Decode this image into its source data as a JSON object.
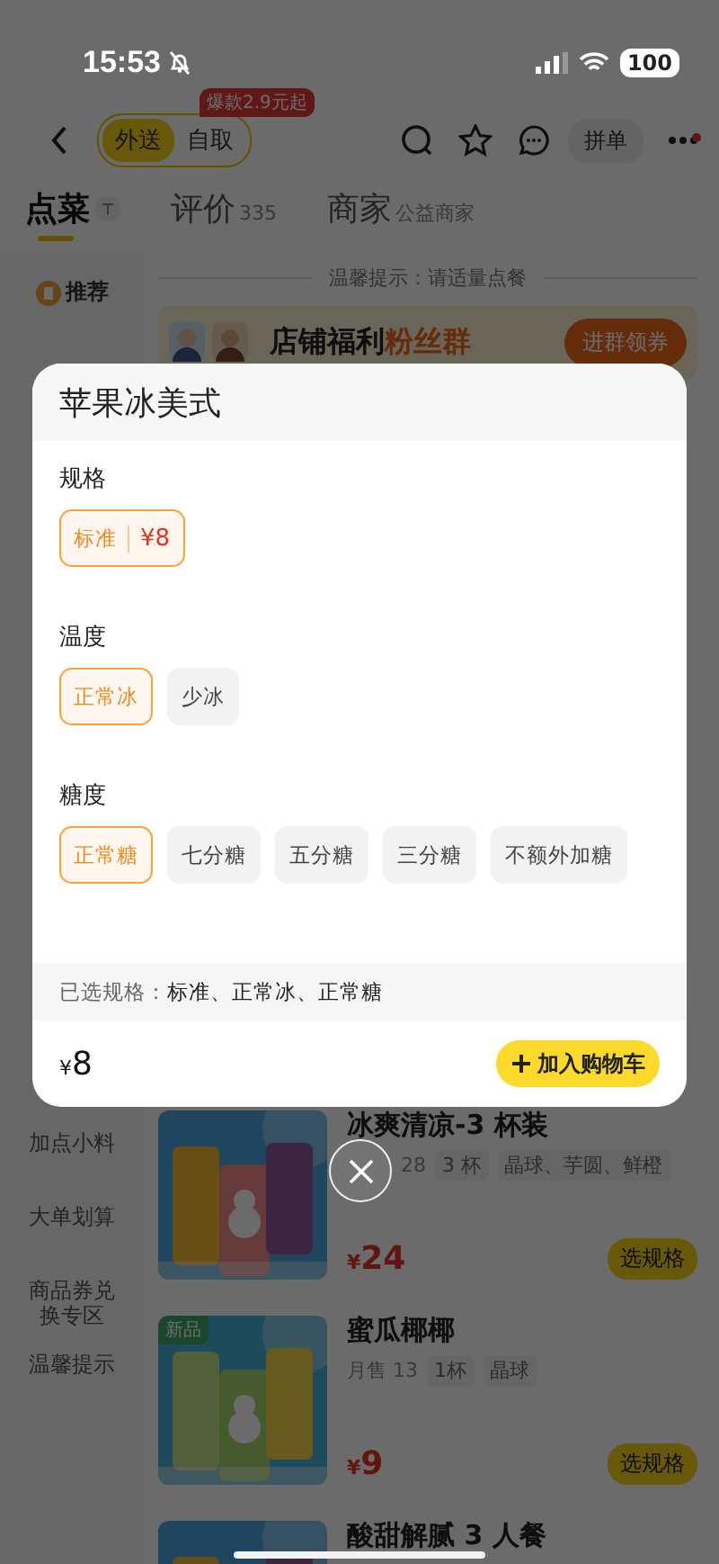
{
  "status_bar": {
    "time": "15:53",
    "battery": "100"
  },
  "nav": {
    "modes": [
      {
        "label": "外送",
        "selected": true
      },
      {
        "label": "自取",
        "selected": false
      }
    ],
    "promo_badge": "爆款2.9元起",
    "group_order": "拼单",
    "has_notification": true
  },
  "tabs": [
    {
      "label": "点菜",
      "selected": true
    },
    {
      "label": "评价",
      "count": "335",
      "selected": false
    },
    {
      "label": "商家",
      "count": "公益商家",
      "selected": false
    }
  ],
  "notice": "温馨提示：请适量点餐",
  "banner": {
    "title": "店铺福利",
    "highlight": "粉丝群",
    "button": "进群领券"
  },
  "sidebar": {
    "top": {
      "label": "推荐"
    },
    "items": [
      "加点小料",
      "大单划算",
      "商品券兑换专区",
      "温馨提示"
    ]
  },
  "products": [
    {
      "name": "冰爽清凉-3 杯装",
      "sales": "28",
      "sales_partly_hidden": true,
      "tags": [
        "3 杯",
        "晶球、芋圆、鲜橙"
      ],
      "currency": "¥",
      "price": "24",
      "button": "选规格"
    },
    {
      "name": "蜜瓜椰椰",
      "sales": "月售 13",
      "sales_partly_hidden": false,
      "tags": [
        "1杯",
        "晶球"
      ],
      "currency": "¥",
      "price": "9",
      "badge": "新品",
      "button": "选规格"
    },
    {
      "name": "酸甜解腻 3 人餐"
    }
  ],
  "dialog": {
    "title": "苹果冰美式",
    "groups": [
      {
        "label": "规格",
        "options": [
          {
            "label": "标准",
            "price": "¥8",
            "selected": true
          }
        ]
      },
      {
        "label": "温度",
        "options": [
          {
            "label": "正常冰",
            "selected": true
          },
          {
            "label": "少冰",
            "selected": false
          }
        ]
      },
      {
        "label": "糖度",
        "options": [
          {
            "label": "正常糖",
            "selected": true
          },
          {
            "label": "七分糖",
            "selected": false
          },
          {
            "label": "五分糖",
            "selected": false
          },
          {
            "label": "三分糖",
            "selected": false
          },
          {
            "label": "不额外加糖",
            "selected": false
          }
        ]
      }
    ],
    "summary_label": "已选规格：",
    "summary_value": "标准、正常冰、正常糖",
    "currency": "¥",
    "price": "8",
    "add_button": "加入购物车"
  }
}
